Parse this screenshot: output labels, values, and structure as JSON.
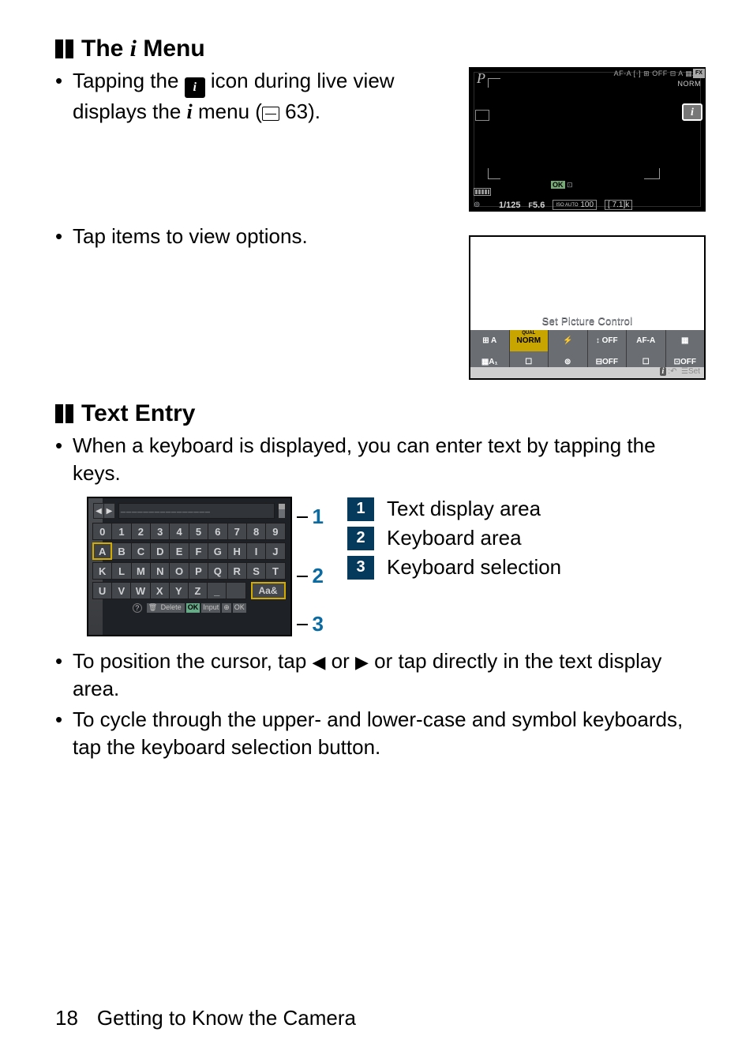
{
  "headings": {
    "imenu_pre": "The ",
    "imenu_post": " Menu",
    "textentry": "Text Entry"
  },
  "imenu": {
    "bullet1_a": "Tapping the ",
    "bullet1_b": " icon during live view displays the ",
    "bullet1_c": " menu (",
    "bullet1_ref": " 63).",
    "bullet2": "Tap items to view options."
  },
  "lcd": {
    "p": "P",
    "top_icons": "AF-A [·] ⊞ OFF ⊟ A ▦A₀",
    "norm": "NORM",
    "fx": "FX",
    "i": "i",
    "ok": "OK",
    "gear": "⊚",
    "shutter": "1/125",
    "aperture_pre": "F",
    "aperture": "5.6",
    "iso_label": "ISO AUTO",
    "iso": "100",
    "count": "[   7.1]k"
  },
  "spc": {
    "title": "Set Picture Control",
    "row1": [
      "⊞ A",
      "NORM",
      "⚡",
      "↕ OFF",
      "AF-A",
      "▦"
    ],
    "row2": [
      "▦A₁",
      "☐",
      "⊚",
      "⊟OFF",
      "☐",
      "⊡OFF"
    ],
    "footer_back": "↶",
    "footer_set": "Set"
  },
  "textentry": {
    "intro": "When a keyboard is displayed, you can enter text by tapping the keys.",
    "legend": {
      "1": "Text display area",
      "2": "Keyboard area",
      "3": "Keyboard selection"
    },
    "kb": {
      "textfield": "________________",
      "rows": [
        [
          "0",
          "1",
          "2",
          "3",
          "4",
          "5",
          "6",
          "7",
          "8",
          "9"
        ],
        [
          "A",
          "B",
          "C",
          "D",
          "E",
          "F",
          "G",
          "H",
          "I",
          "J"
        ],
        [
          "K",
          "L",
          "M",
          "N",
          "O",
          "P",
          "Q",
          "R",
          "S",
          "T"
        ],
        [
          "U",
          "V",
          "W",
          "X",
          "Y",
          "Z",
          "_"
        ]
      ],
      "mode": "Aa&",
      "footer": {
        "help": "?",
        "delete": "Delete",
        "ok": "OK",
        "input": "Input",
        "mag": "⊕",
        "okend": "OK"
      }
    },
    "bullet_cursor_a": "To position the cursor, tap ",
    "bullet_cursor_b": " or ",
    "bullet_cursor_c": " or tap directly in the text display area.",
    "bullet_cycle": "To cycle through the upper- and lower-case and symbol keyboards, tap the keyboard selection button."
  },
  "footer": {
    "page": "18",
    "section": "Getting to Know the Camera"
  }
}
